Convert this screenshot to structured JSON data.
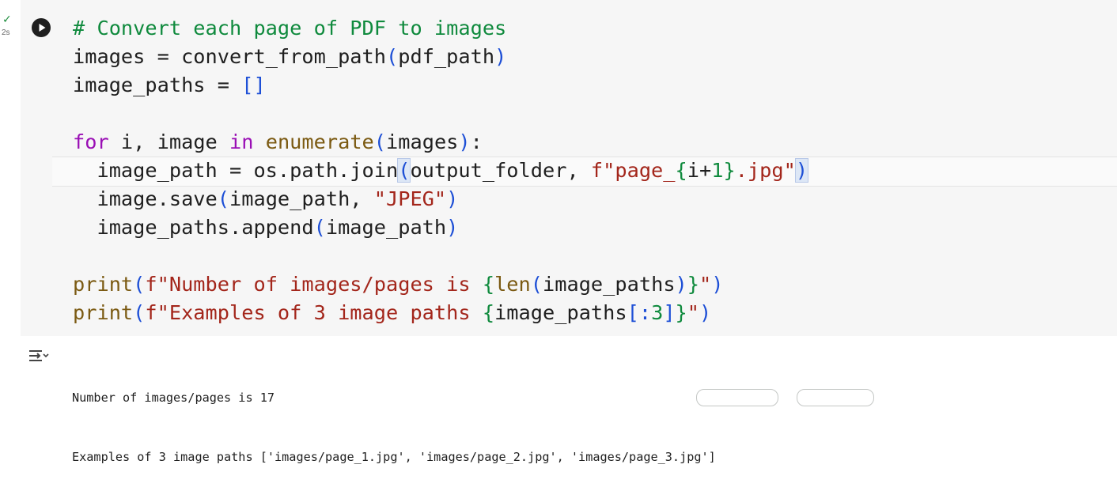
{
  "cell": {
    "status": "✓",
    "exec_time": "2s",
    "code_lines": [
      [
        {
          "t": "# Convert each page of PDF to images",
          "c": "comment"
        }
      ],
      [
        {
          "t": "images = ",
          "c": "default"
        },
        {
          "t": "convert_from_path",
          "c": "default"
        },
        {
          "t": "(",
          "c": "p1"
        },
        {
          "t": "pdf_path",
          "c": "default"
        },
        {
          "t": ")",
          "c": "p1"
        }
      ],
      [
        {
          "t": "image_paths = ",
          "c": "default"
        },
        {
          "t": "[]",
          "c": "p1"
        }
      ],
      [],
      [
        {
          "t": "for",
          "c": "kw"
        },
        {
          "t": " i, image ",
          "c": "default"
        },
        {
          "t": "in",
          "c": "kw"
        },
        {
          "t": " ",
          "c": "default"
        },
        {
          "t": "enumerate",
          "c": "builtin"
        },
        {
          "t": "(",
          "c": "p1"
        },
        {
          "t": "images",
          "c": "default"
        },
        {
          "t": ")",
          "c": "p1"
        },
        {
          "t": ":",
          "c": "default"
        }
      ],
      [
        {
          "t": "  image_path = os.path.join",
          "c": "default"
        },
        {
          "t": "(",
          "c": "p1",
          "hl": true
        },
        {
          "t": "output_folder, ",
          "c": "default"
        },
        {
          "t": "f\"page_",
          "c": "str"
        },
        {
          "t": "{",
          "c": "brace"
        },
        {
          "t": "i+",
          "c": "default"
        },
        {
          "t": "1",
          "c": "num"
        },
        {
          "t": "}",
          "c": "brace"
        },
        {
          "t": ".jpg\"",
          "c": "str"
        },
        {
          "t": ")",
          "c": "p1",
          "hl": true
        }
      ],
      [
        {
          "t": "  image.save",
          "c": "default"
        },
        {
          "t": "(",
          "c": "p1"
        },
        {
          "t": "image_path, ",
          "c": "default"
        },
        {
          "t": "\"JPEG\"",
          "c": "str"
        },
        {
          "t": ")",
          "c": "p1"
        }
      ],
      [
        {
          "t": "  image_paths.append",
          "c": "default"
        },
        {
          "t": "(",
          "c": "p1"
        },
        {
          "t": "image_path",
          "c": "default"
        },
        {
          "t": ")",
          "c": "p1"
        }
      ],
      [],
      [
        {
          "t": "print",
          "c": "builtin"
        },
        {
          "t": "(",
          "c": "p1"
        },
        {
          "t": "f\"Number of images/pages is ",
          "c": "str"
        },
        {
          "t": "{",
          "c": "brace"
        },
        {
          "t": "len",
          "c": "builtin"
        },
        {
          "t": "(",
          "c": "p2"
        },
        {
          "t": "image_paths",
          "c": "default"
        },
        {
          "t": ")",
          "c": "p2"
        },
        {
          "t": "}",
          "c": "brace"
        },
        {
          "t": "\"",
          "c": "str"
        },
        {
          "t": ")",
          "c": "p1"
        }
      ],
      [
        {
          "t": "print",
          "c": "builtin"
        },
        {
          "t": "(",
          "c": "p1"
        },
        {
          "t": "f\"Examples of 3 image paths ",
          "c": "str"
        },
        {
          "t": "{",
          "c": "brace"
        },
        {
          "t": "image_paths",
          "c": "default"
        },
        {
          "t": "[:",
          "c": "p2"
        },
        {
          "t": "3",
          "c": "num"
        },
        {
          "t": "]",
          "c": "p2"
        },
        {
          "t": "}",
          "c": "brace"
        },
        {
          "t": "\"",
          "c": "str"
        },
        {
          "t": ")",
          "c": "p1"
        }
      ]
    ]
  },
  "output": {
    "lines": [
      "Number of images/pages is 17",
      "Examples of 3 image paths ['images/page_1.jpg', 'images/page_2.jpg', 'images/page_3.jpg']"
    ]
  },
  "colors": {
    "comment": "#0f8a3d",
    "keyword": "#9a0fb5",
    "builtin": "#7b5a12",
    "string": "#a3261b",
    "number": "#0f8a3d",
    "bracket": "#1d4fd6",
    "brace": "#0f8a3d",
    "success": "#1e8e3e",
    "cell_bg": "#f6f6f6"
  },
  "icons": {
    "run": "play-circle-icon",
    "output_toggle": "output-collapse-icon",
    "status": "check-icon"
  }
}
